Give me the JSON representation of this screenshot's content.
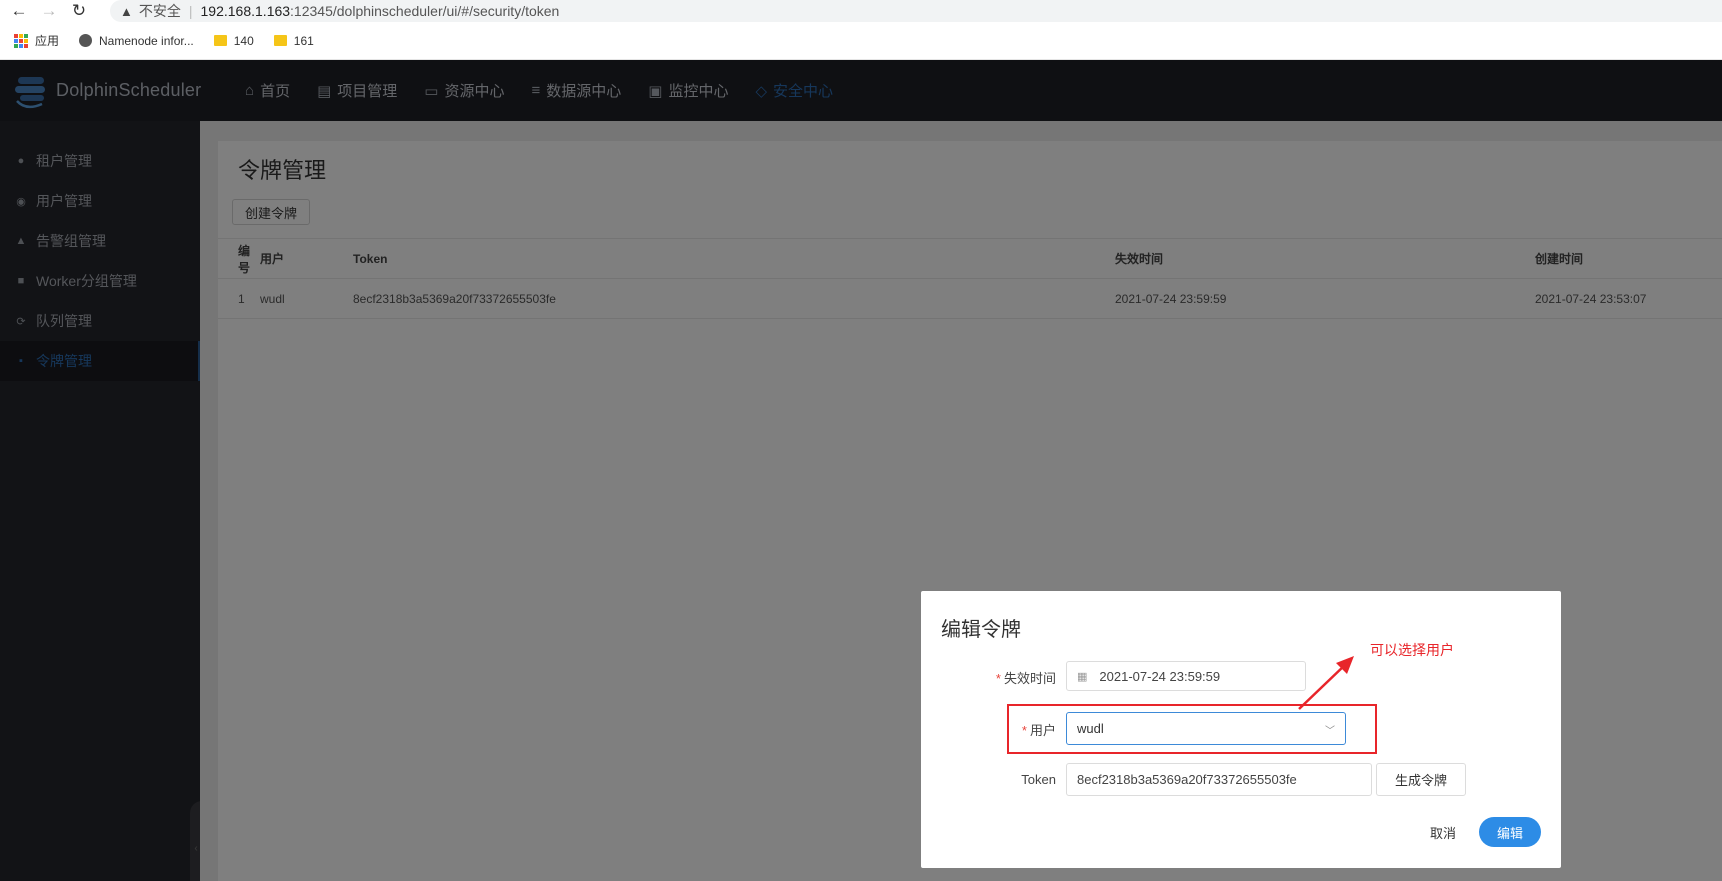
{
  "browser": {
    "back_icon": "arrow-left-icon",
    "forward_icon": "arrow-right-icon",
    "reload_icon": "reload-icon",
    "security_warning": "不安全",
    "url_host": "192.168.1.163",
    "url_rest": ":12345/dolphinscheduler/ui/#/security/token",
    "bookmarks": [
      {
        "label": "应用",
        "icon": "apps-grid-icon"
      },
      {
        "label": "Namenode infor...",
        "icon": "globe-icon"
      },
      {
        "label": "140",
        "icon": "folder-icon"
      },
      {
        "label": "161",
        "icon": "folder-icon"
      }
    ]
  },
  "app": {
    "name": "DolphinScheduler",
    "nav": [
      {
        "label": "首页",
        "icon": "home-icon"
      },
      {
        "label": "项目管理",
        "icon": "project-icon"
      },
      {
        "label": "资源中心",
        "icon": "folder-icon"
      },
      {
        "label": "数据源中心",
        "icon": "database-icon"
      },
      {
        "label": "监控中心",
        "icon": "monitor-icon"
      },
      {
        "label": "安全中心",
        "icon": "shield-icon",
        "active": true
      }
    ],
    "sidebar": [
      {
        "label": "租户管理",
        "icon": "user-icon"
      },
      {
        "label": "用户管理",
        "icon": "user-circle-icon"
      },
      {
        "label": "告警组管理",
        "icon": "warning-icon"
      },
      {
        "label": "Worker分组管理",
        "icon": "id-card-icon"
      },
      {
        "label": "队列管理",
        "icon": "refresh-icon"
      },
      {
        "label": "令牌管理",
        "icon": "document-icon",
        "active": true
      }
    ]
  },
  "page": {
    "title": "令牌管理",
    "create_button": "创建令牌",
    "table": {
      "headers": [
        "编号",
        "用户",
        "Token",
        "失效时间",
        "创建时间"
      ],
      "rows": [
        [
          "1",
          "wudl",
          "8ecf2318b3a5369a20f73372655503fe",
          "2021-07-24 23:59:59",
          "2021-07-24 23:53:07"
        ]
      ]
    }
  },
  "modal": {
    "title": "编辑令牌",
    "expire_label": "失效时间",
    "expire_value": "2021-07-24 23:59:59",
    "user_label": "用户",
    "user_value": "wudl",
    "token_label": "Token",
    "token_value": "8ecf2318b3a5369a20f73372655503fe",
    "generate_button": "生成令牌",
    "cancel_button": "取消",
    "edit_button": "编辑",
    "required_mark": "*"
  },
  "annotation": {
    "text": "可以选择用户",
    "color": "#e8252a"
  },
  "colors": {
    "header_bg": "#1f2026",
    "sidebar_bg": "#25262c",
    "active_accent": "#2d6fb7",
    "primary_button": "#2d8ce6"
  }
}
